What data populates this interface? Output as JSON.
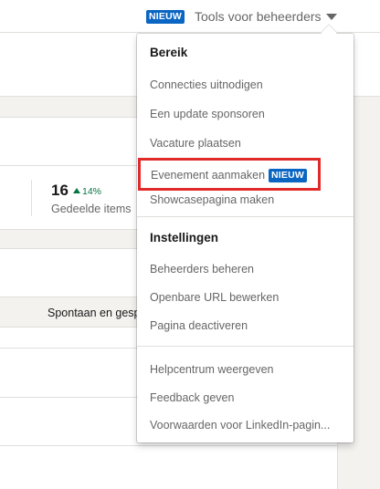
{
  "topbar": {
    "new_badge": "NIEUW",
    "admin_tools": "Tools voor beheerders",
    "caret_icon": "caret-down-icon"
  },
  "background": {
    "stat_value": "16",
    "stat_trend": "14%",
    "stat_label": "Gedeelde items",
    "column_header": "Spontaan en gesp"
  },
  "menu": {
    "section_reach": {
      "title": "Bereik",
      "items": [
        "Connecties uitnodigen",
        "Een update sponsoren",
        "Vacature plaatsen",
        "Evenement aanmaken",
        "Showcasepagina maken"
      ],
      "new_badge": "NIEUW"
    },
    "section_settings": {
      "title": "Instellingen",
      "items": [
        "Beheerders beheren",
        "Openbare URL bewerken",
        "Pagina deactiveren"
      ]
    },
    "section_help": {
      "items": [
        "Helpcentrum weergeven",
        "Feedback geven",
        "Voorwaarden voor LinkedIn-pagin..."
      ]
    }
  },
  "colors": {
    "brand_blue": "#0a66c2",
    "highlight_red": "#e02a2a",
    "trend_green": "#057642"
  }
}
